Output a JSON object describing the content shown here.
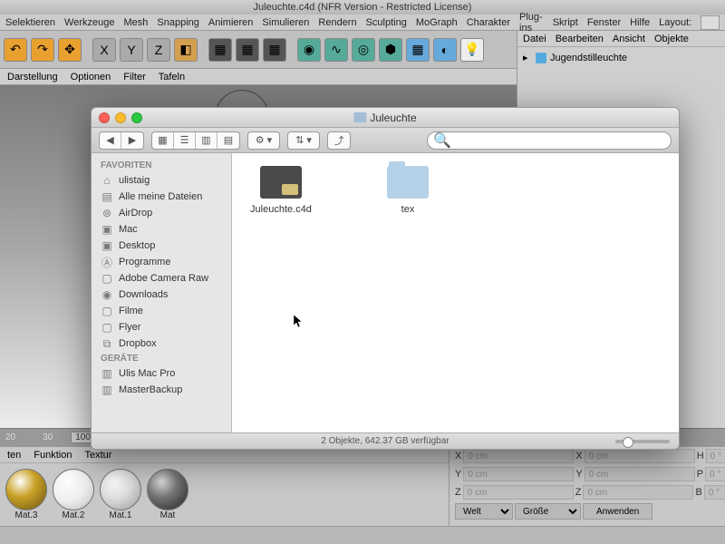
{
  "c4d": {
    "title": "Juleuchte.c4d (NFR Version - Restricted License)",
    "menu": [
      "Selektieren",
      "Werkzeuge",
      "Mesh",
      "Snapping",
      "Animieren",
      "Simulieren",
      "Rendern",
      "Sculpting",
      "MoGraph",
      "Charakter",
      "Plug-ins",
      "Skript",
      "Fenster",
      "Hilfe"
    ],
    "layout_label": "Layout:",
    "subbar": [
      "Darstellung",
      "Optionen",
      "Filter",
      "Tafeln"
    ],
    "rightpanel": {
      "menu": [
        "Datei",
        "Bearbeiten",
        "Ansicht",
        "Objekte"
      ],
      "tree_item": "Jugendstilleuchte"
    },
    "matbar": {
      "tabs": [
        "ten",
        "Funktion",
        "Textur"
      ],
      "materials": [
        "Mat.3",
        "Mat.2",
        "Mat.1",
        "Mat"
      ]
    },
    "timeline": {
      "t1": "20",
      "t2": "30",
      "frame": "100 B",
      "frame2": "100"
    },
    "attr": {
      "X": "X",
      "Y": "Y",
      "Z": "Z",
      "H": "H",
      "P": "P",
      "B": "B",
      "val": "0 cm",
      "ang": "0 °",
      "welt": "Welt",
      "groesse": "Größe",
      "anwenden": "Anwenden"
    }
  },
  "finder": {
    "title": "Juleuchte",
    "sidebar": {
      "section1": "Favoriten",
      "items1": [
        {
          "icon": "⌂",
          "label": "ulistaig"
        },
        {
          "icon": "▤",
          "label": "Alle meine Dateien"
        },
        {
          "icon": "⊚",
          "label": "AirDrop"
        },
        {
          "icon": "▣",
          "label": "Mac"
        },
        {
          "icon": "▣",
          "label": "Desktop"
        },
        {
          "icon": "Ⓐ",
          "label": "Programme"
        },
        {
          "icon": "▢",
          "label": "Adobe Camera Raw"
        },
        {
          "icon": "◉",
          "label": "Downloads"
        },
        {
          "icon": "▢",
          "label": "Filme"
        },
        {
          "icon": "▢",
          "label": "Flyer"
        },
        {
          "icon": "⧉",
          "label": "Dropbox"
        }
      ],
      "section2": "Geräte",
      "items2": [
        {
          "icon": "▥",
          "label": "Ulis Mac Pro"
        },
        {
          "icon": "▥",
          "label": "MasterBackup"
        }
      ]
    },
    "files": [
      {
        "name": "Juleuchte.c4d",
        "type": "c4d"
      },
      {
        "name": "tex",
        "type": "folder"
      }
    ],
    "status": "2 Objekte, 642.37 GB verfügbar",
    "search_placeholder": ""
  }
}
